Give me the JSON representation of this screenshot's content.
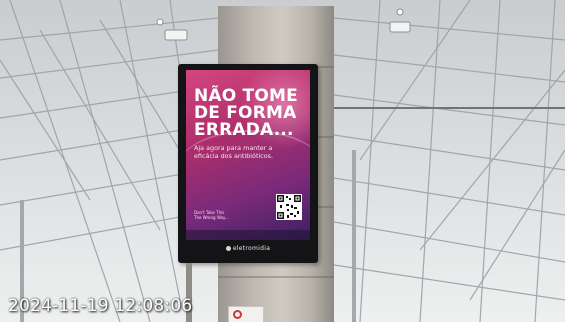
{
  "scene": {
    "kind": "train station interior with digital advertising totem on a concrete pillar"
  },
  "ad_screen": {
    "headline_lines": [
      "NÃO TOME",
      "DE FORMA",
      "ERRADA..."
    ],
    "subtext_lines": [
      "Aja agora para manter a",
      "eficácia dos antibióticos."
    ],
    "fine_print_left": [
      "Don't Take This",
      "The Wrong Way..."
    ],
    "brand": "eletromidia",
    "colors": {
      "background_top": "#d44680",
      "background_bottom": "#3c2060",
      "headline": "#ffffff"
    }
  },
  "overlay": {
    "timestamp": "2024-11-19 12:08:06"
  },
  "icons": {
    "qr": "qr-code-icon",
    "brand_mark": "eletromidia-logo-icon",
    "sign": "prohibition-sign-icon"
  }
}
